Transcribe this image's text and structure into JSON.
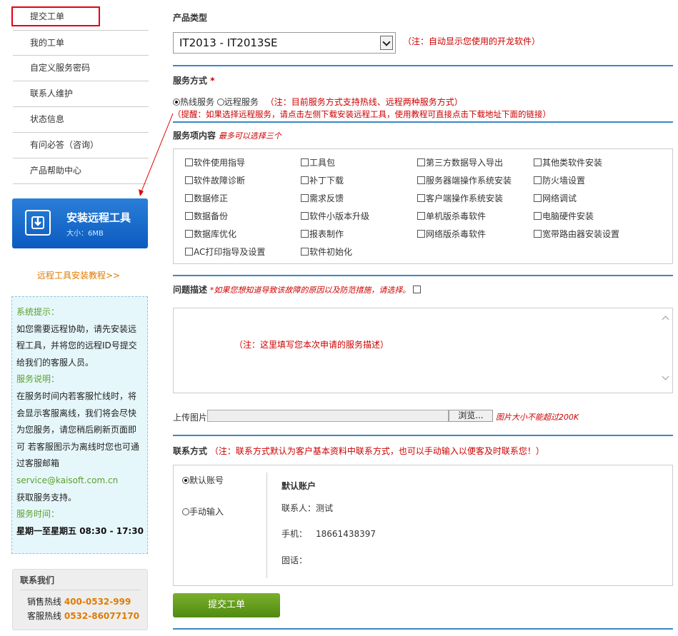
{
  "sidebar": {
    "items": [
      {
        "label": "提交工单",
        "active": true
      },
      {
        "label": "我的工单"
      },
      {
        "label": "自定义服务密码"
      },
      {
        "label": "联系人维护"
      },
      {
        "label": "状态信息"
      },
      {
        "label": "有问必答（咨询）"
      },
      {
        "label": "产品帮助中心"
      }
    ],
    "install": {
      "title": "安装远程工具",
      "size": "大小：6MB"
    },
    "tutorial_link": "远程工具安装教程>>",
    "notice": {
      "system_title": "系统提示：",
      "system_lines": [
        "如您需要远程协助，请先安装远",
        "程工具，并将您的远程ID号提交",
        "给我们的客服人员。"
      ],
      "service_title": "服务说明：",
      "service_lines": [
        "在服务时间内若客服忙线时，将",
        "会显示客服离线，我们将会尽快",
        "为您服务，请您稍后刷新页面即",
        "可 若客服图示为离线时您也可通",
        "过客服邮箱"
      ],
      "email": "service@kaisoft.com.cn",
      "email_after": "获取服务支持。",
      "time_title": "服务时间：",
      "time_days": "星期一至星期五",
      "time_hours": "08:30 - 17:30"
    },
    "contact": {
      "title": "联系我们",
      "sales_label": "销售热线",
      "sales_number": "400-0532-999",
      "support_label": "客服热线",
      "support_number": "0532-86077170"
    }
  },
  "main": {
    "product_type": {
      "label": "产品类型",
      "value": "IT2013 - IT2013SE",
      "note": "（注：自动显示您使用的开龙软件）"
    },
    "service_mode": {
      "label": "服务方式",
      "required": "*",
      "options": [
        "热线服务",
        "远程服务"
      ],
      "note": "（注：目前服务方式支持热线、远程两种服务方式）",
      "hint": "（提醒：如果选择远程服务，请点击左侧下载安装远程工具，使用教程可直接点击下载地址下面的链接）"
    },
    "service_items": {
      "label": "服务项内容",
      "note": "最多可以选择三个",
      "rows": [
        [
          "软件使用指导",
          "工具包",
          "第三方数据导入导出",
          "其他类软件安装"
        ],
        [
          "软件故障诊断",
          "补丁下载",
          "服务器端操作系统安装",
          "防火墙设置"
        ],
        [
          "数据修正",
          "需求反馈",
          "客户端操作系统安装",
          "网络调试"
        ],
        [
          "数据备份",
          "软件小版本升级",
          "单机版杀毒软件",
          "电脑硬件安装"
        ],
        [
          "数据库优化",
          "报表制作",
          "网络版杀毒软件",
          "宽带路由器安装设置"
        ],
        [
          "AC打印指导及设置",
          "软件初始化"
        ]
      ]
    },
    "problem": {
      "label": "问题描述",
      "note": "*如果您想知道导致该故障的原因以及防范措施，请选择。",
      "placeholder": "（注：这里填写您本次申请的服务描述）"
    },
    "upload": {
      "label": "上传图片",
      "browse": "浏览...",
      "note": "图片大小不能超过200K"
    },
    "contact_mode": {
      "label": "联系方式",
      "note": "（注：联系方式默认为客户基本资料中联系方式，也可以手动输入以便客及时联系您！）",
      "options": [
        "默认账号",
        "手动输入"
      ],
      "account_title": "默认账户",
      "contact_person": "联系人：测试",
      "phone_label": "手机：",
      "phone": "18661438397",
      "landline_label": "固话："
    },
    "submit": "提交工单"
  }
}
